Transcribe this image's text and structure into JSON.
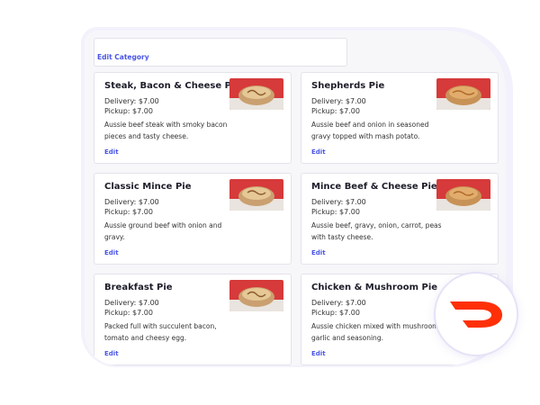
{
  "category": {
    "edit_label": "Edit Category"
  },
  "items": [
    {
      "title": "Steak, Bacon & Cheese Pie",
      "delivery": "Delivery: $7.00",
      "pickup": "Pickup: $7.00",
      "description": "Aussie beef steak with smoky bacon pieces and tasty cheese.",
      "edit_label": "Edit"
    },
    {
      "title": "Shepherds Pie",
      "delivery": "Delivery: $7.00",
      "pickup": "Pickup: $7.00",
      "description": "Aussie beef and onion in seasoned gravy topped with mash potato.",
      "edit_label": "Edit"
    },
    {
      "title": "Classic Mince Pie",
      "delivery": "Delivery: $7.00",
      "pickup": "Pickup: $7.00",
      "description": "Aussie ground beef with onion and gravy.",
      "edit_label": "Edit"
    },
    {
      "title": "Mince Beef & Cheese Pie",
      "delivery": "Delivery: $7.00",
      "pickup": "Pickup: $7.00",
      "description": "Aussie beef, gravy, onion, carrot, peas with tasty cheese.",
      "edit_label": "Edit"
    },
    {
      "title": "Breakfast Pie",
      "delivery": "Delivery: $7.00",
      "pickup": "Pickup: $7.00",
      "description": "Packed full with succulent bacon, tomato and cheesy egg.",
      "edit_label": "Edit"
    },
    {
      "title": "Chicken & Mushroom Pie",
      "delivery": "Delivery: $7.00",
      "pickup": "Pickup: $7.00",
      "description": "Aussie chicken mixed with mushroom, garlic and seasoning.",
      "edit_label": "Edit"
    }
  ],
  "colors": {
    "accent": "#4a55e6",
    "brand_logo": "#ff3008"
  },
  "logo_icon": "doordash-logo-icon"
}
